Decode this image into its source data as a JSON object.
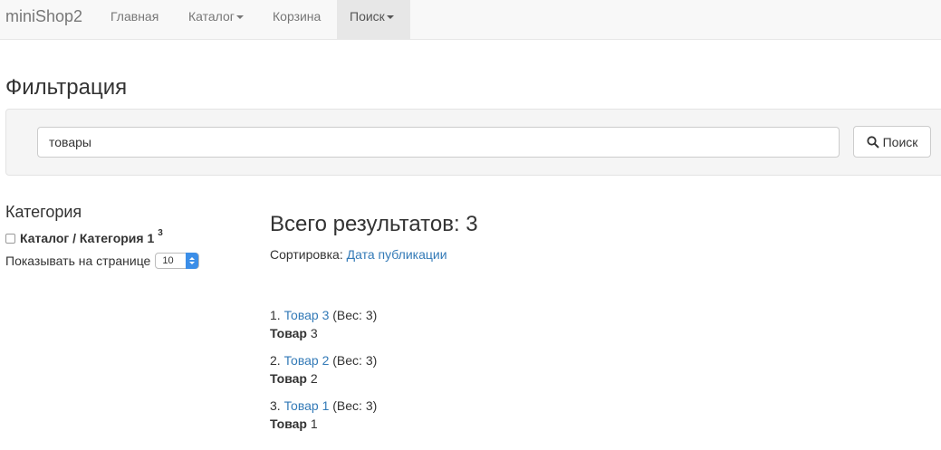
{
  "navbar": {
    "brand": "miniShop2",
    "items": [
      {
        "label": "Главная",
        "dropdown": false
      },
      {
        "label": "Каталог",
        "dropdown": true
      },
      {
        "label": "Корзина",
        "dropdown": false
      },
      {
        "label": "Поиск",
        "dropdown": true,
        "active": true
      }
    ]
  },
  "page": {
    "title": "Фильтрация"
  },
  "search": {
    "value": "товары",
    "button_label": "Поиск",
    "button_icon": "search-icon"
  },
  "sidebar": {
    "title": "Категория",
    "filters": [
      {
        "label": "Каталог / Категория 1",
        "count": "3",
        "checked": false
      }
    ],
    "per_page_label": "Показывать на странице",
    "per_page_value": "10"
  },
  "results": {
    "title": "Всего результатов: 3",
    "sort_label": "Сортировка:",
    "sort_value": "Дата публикации",
    "items": [
      {
        "num": "1.",
        "link": "Товар 3",
        "weight": "(Вес: 3)",
        "bold": "Товар",
        "suffix": "3"
      },
      {
        "num": "2.",
        "link": "Товар 2",
        "weight": "(Вес: 3)",
        "bold": "Товар",
        "suffix": "2"
      },
      {
        "num": "3.",
        "link": "Товар 1",
        "weight": "(Вес: 3)",
        "bold": "Товар",
        "suffix": "1"
      }
    ]
  },
  "colors": {
    "link": "#337ab7",
    "navbar_bg": "#f8f8f8",
    "active_nav_bg": "#e7e7e7",
    "select_accent": "#3b8ee8"
  }
}
